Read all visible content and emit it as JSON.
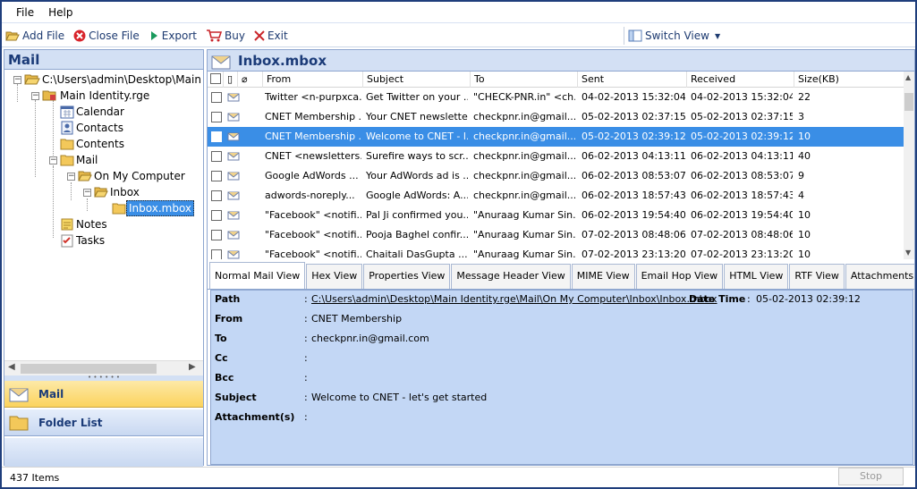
{
  "menu": [
    "File",
    "Help"
  ],
  "toolbar": {
    "add_file": "Add File",
    "close_file": "Close File",
    "export": "Export",
    "buy": "Buy",
    "exit": "Exit",
    "switch_view": "Switch View"
  },
  "left": {
    "title": "Mail",
    "tree": {
      "root": "C:\\Users\\admin\\Desktop\\Main Id",
      "identity": "Main Identity.rge",
      "calendar": "Calendar",
      "contacts": "Contacts",
      "contents": "Contents",
      "mail": "Mail",
      "on_my_computer": "On My Computer",
      "inbox": "Inbox",
      "inbox_mbox": "Inbox.mbox",
      "notes": "Notes",
      "tasks": "Tasks"
    },
    "nav": {
      "mail": "Mail",
      "folder_list": "Folder List"
    }
  },
  "right": {
    "title": "Inbox.mbox",
    "columns": [
      "From",
      "Subject",
      "To",
      "Sent",
      "Received",
      "Size(KB)"
    ],
    "rows": [
      {
        "from": "Twitter <n-purpxca...",
        "subject": "Get Twitter on your ...",
        "to": "\"CHECK-PNR.in\" <ch...",
        "sent": "04-02-2013 15:32:04",
        "received": "04-02-2013 15:32:04",
        "size": "22"
      },
      {
        "from": "CNET Membership ...",
        "subject": "Your CNET newslette...",
        "to": "checkpnr.in@gmail....",
        "sent": "05-02-2013 02:37:15",
        "received": "05-02-2013 02:37:15",
        "size": "3"
      },
      {
        "from": "CNET Membership ...",
        "subject": "Welcome to CNET - l...",
        "to": "checkpnr.in@gmail....",
        "sent": "05-02-2013 02:39:12",
        "received": "05-02-2013 02:39:12",
        "size": "10"
      },
      {
        "from": "CNET <newsletters...",
        "subject": "Surefire ways to scr...",
        "to": "checkpnr.in@gmail....",
        "sent": "06-02-2013 04:13:11",
        "received": "06-02-2013 04:13:11",
        "size": "40"
      },
      {
        "from": "Google AdWords ...",
        "subject": "Your AdWords ad is ...",
        "to": "checkpnr.in@gmail....",
        "sent": "06-02-2013 08:53:07",
        "received": "06-02-2013 08:53:07",
        "size": "9"
      },
      {
        "from": "adwords-noreply...",
        "subject": "Google AdWords: A...",
        "to": "checkpnr.in@gmail....",
        "sent": "06-02-2013 18:57:43",
        "received": "06-02-2013 18:57:43",
        "size": "4"
      },
      {
        "from": "\"Facebook\" <notifi...",
        "subject": "Pal Ji confirmed you...",
        "to": "\"Anuraag Kumar Sin...",
        "sent": "06-02-2013 19:54:40",
        "received": "06-02-2013 19:54:40",
        "size": "10"
      },
      {
        "from": "\"Facebook\" <notifi...",
        "subject": "Pooja Baghel confir...",
        "to": "\"Anuraag Kumar Sin...",
        "sent": "07-02-2013 08:48:06",
        "received": "07-02-2013 08:48:06",
        "size": "10"
      },
      {
        "from": "\"Facebook\" <notifi...",
        "subject": "Chaitali DasGupta ...",
        "to": "\"Anuraag Kumar Sin...",
        "sent": "07-02-2013 23:13:20",
        "received": "07-02-2013 23:13:20",
        "size": "10"
      }
    ],
    "tabs": [
      "Normal Mail View",
      "Hex View",
      "Properties View",
      "Message Header View",
      "MIME View",
      "Email Hop View",
      "HTML View",
      "RTF View",
      "Attachments"
    ],
    "detail": {
      "path_label": "Path",
      "path_value": "C:\\Users\\admin\\Desktop\\Main Identity.rge\\Mail\\On My Computer\\Inbox\\Inbox.mbox",
      "date_label": "Date Time",
      "date_value": "05-02-2013 02:39:12",
      "from_label": "From",
      "from_value": "CNET Membership",
      "to_label": "To",
      "to_value": "checkpnr.in@gmail.com",
      "cc_label": "Cc",
      "bcc_label": "Bcc",
      "subject_label": "Subject",
      "subject_value": "Welcome to CNET - let's get started",
      "attachments_label": "Attachment(s)",
      "colon": ":"
    }
  },
  "status": {
    "items": "437 Items",
    "stop": "Stop"
  }
}
